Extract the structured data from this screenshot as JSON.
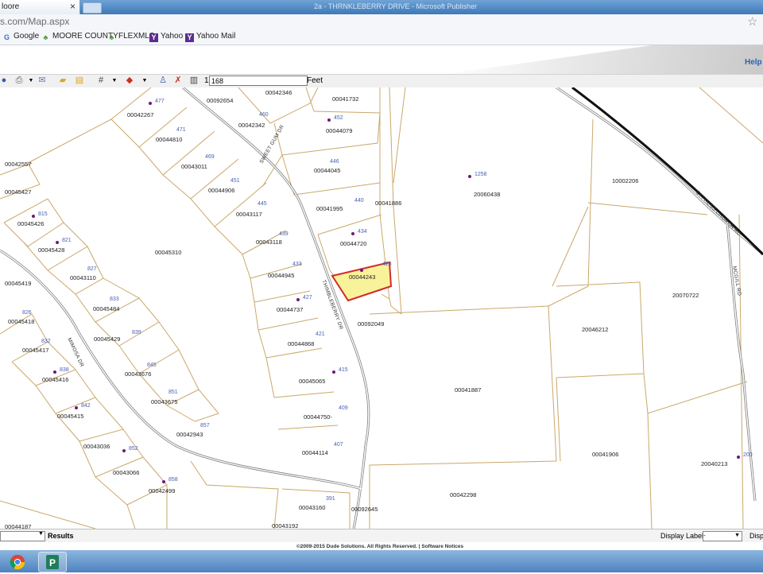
{
  "browser": {
    "tab_title": "loore",
    "tab_close": "×",
    "window_caption": "2a - THRNKLEBERRY DRIVE - Microsoft Publisher",
    "url": "s.com/Map.aspx",
    "bookmarks": [
      {
        "label": "Google",
        "icon": "google-icon"
      },
      {
        "label": "MOORE COUNTY",
        "icon": "bookmark-icon"
      },
      {
        "label": "FLEXMLS",
        "icon": "bookmark-icon"
      },
      {
        "label": "Yahoo",
        "icon": "yahoo-icon"
      },
      {
        "label": "Yahoo Mail",
        "icon": "yahoo-icon"
      }
    ]
  },
  "header": {
    "help": "Help"
  },
  "toolbar": {
    "scale_prefix": "1:",
    "scale_value": "168",
    "unit": "Feet"
  },
  "map": {
    "selected_parcel": {
      "id": "00044243",
      "number": "428"
    },
    "parcels": [
      {
        "id": "00042267",
        "num": "477"
      },
      {
        "id": "00044810",
        "num": "471"
      },
      {
        "id": "00043011",
        "num": "469"
      },
      {
        "id": "00044906",
        "num": "451"
      },
      {
        "id": "00043117",
        "num": "445"
      },
      {
        "id": "00043118",
        "num": "439"
      },
      {
        "id": "00044945",
        "num": "433"
      },
      {
        "id": "00044737",
        "num": "427"
      },
      {
        "id": "00044868",
        "num": "421"
      },
      {
        "id": "00045065",
        "num": "415"
      },
      {
        "id": "00044750-",
        "num": "409"
      },
      {
        "id": "00044114",
        "num": "407"
      },
      {
        "id": "00043160",
        "num": "391"
      },
      {
        "id": "00043192",
        "num": ""
      },
      {
        "id": "00092654",
        "num": ""
      },
      {
        "id": "00042346",
        "num": ""
      },
      {
        "id": "00042342",
        "num": "460"
      },
      {
        "id": "00041732",
        "num": ""
      },
      {
        "id": "00044079",
        "num": "452"
      },
      {
        "id": "00044045",
        "num": "446"
      },
      {
        "id": "00041995",
        "num": "440"
      },
      {
        "id": "00044720",
        "num": "434"
      },
      {
        "id": "00041886",
        "num": ""
      },
      {
        "id": "00092049",
        "num": ""
      },
      {
        "id": "00092645",
        "num": ""
      },
      {
        "id": "00041887",
        "num": ""
      },
      {
        "id": "00042298",
        "num": ""
      },
      {
        "id": "20060438",
        "num": "1258"
      },
      {
        "id": "10002206",
        "num": ""
      },
      {
        "id": "20070722",
        "num": ""
      },
      {
        "id": "20046212",
        "num": ""
      },
      {
        "id": "00041906",
        "num": ""
      },
      {
        "id": "20040213",
        "num": "200"
      },
      {
        "id": "00045310",
        "num": ""
      },
      {
        "id": "00042557",
        "num": ""
      },
      {
        "id": "00045427",
        "num": ""
      },
      {
        "id": "00045426",
        "num": "815"
      },
      {
        "id": "00045428",
        "num": "821"
      },
      {
        "id": "00043110",
        "num": "827"
      },
      {
        "id": "00045419",
        "num": ""
      },
      {
        "id": "00045484",
        "num": "833"
      },
      {
        "id": "00045418",
        "num": "826"
      },
      {
        "id": "00045429",
        "num": "839"
      },
      {
        "id": "00045417",
        "num": "832"
      },
      {
        "id": "00043676",
        "num": "845"
      },
      {
        "id": "00045416",
        "num": "838"
      },
      {
        "id": "00043675",
        "num": "851"
      },
      {
        "id": "00045415",
        "num": "842"
      },
      {
        "id": "00042943",
        "num": "857"
      },
      {
        "id": "00043036",
        "num": ""
      },
      {
        "id": "00043066",
        "num": "852"
      },
      {
        "id": "00042499",
        "num": "858"
      },
      {
        "id": "00044187",
        "num": ""
      }
    ],
    "roads": {
      "sweet_gum": "SWEET GUM DR",
      "thimbleberry": "THIMBLEBERRY DR",
      "mimosa": "MIMOSA DR",
      "cypress_church": "CYPRESS CHURCH RD",
      "mcgill": "MCGILL RD"
    }
  },
  "bottom": {
    "results": "Results",
    "display_labels": "Display Labels",
    "display_labels_value": "-",
    "display2": "Displ",
    "copyright": "©2009-2015 Dude Solutions. All Rights Reserved. | Software Notices"
  },
  "colors": {
    "parcel_line": "#c9a86a",
    "selected_fill": "#f8f29a",
    "selected_stroke": "#d42a2a",
    "road": "#7f7f7f"
  }
}
